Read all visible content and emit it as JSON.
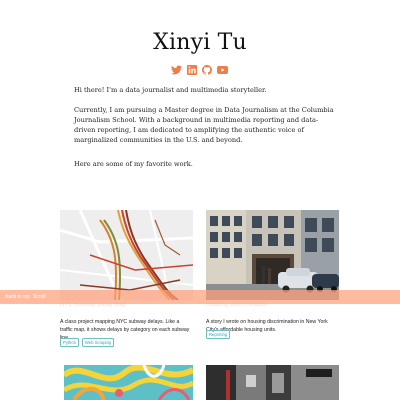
{
  "header": {
    "title": "Xinyi Tu",
    "social_icons": [
      "twitter-icon",
      "linkedin-icon",
      "github-icon",
      "youtube-icon"
    ],
    "icon_color": "#ef7d49"
  },
  "bio": {
    "intro": "Hi there! I'm a data journalist and multimedia storyteller.",
    "background": "Currently, I am pursuing a Master degree in Data Journalism at the Columbia Journalism School. With a background in multimedia reporting and data-driven reporting, I am dedicated to amplifying the authentic voice of marginalized communities in the U.S. and beyond.",
    "favorites": "Here are some of my favorite work."
  },
  "projects": [
    {
      "title": "NYC Subway Delay Map",
      "description": "A class project mapping NYC subway delays. Like a traffic map, it shows delays by category on each subway line.",
      "tags": [
        "Python",
        "Web Scraping"
      ]
    },
    {
      "title": "Housing Discrimination",
      "description": "A story I wrote on housing discrimination in New York City's affordable housing units.",
      "tags": [
        "Reporting"
      ]
    }
  ],
  "banner": {
    "label": "Back to top",
    "link": "Scroll"
  },
  "colors": {
    "accent": "#ef7d49",
    "tag": "#3fa2a8",
    "banner": "#ffa07a"
  }
}
